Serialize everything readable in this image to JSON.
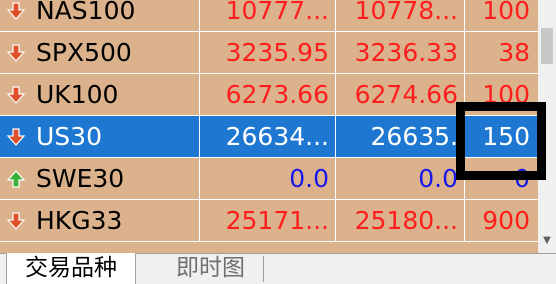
{
  "symbols": [
    {
      "symbol": "NAS100",
      "bid": "10777...",
      "ask": "10778...",
      "spread": "100",
      "direction": "down",
      "color": "red"
    },
    {
      "symbol": "SPX500",
      "bid": "3235.95",
      "ask": "3236.33",
      "spread": "38",
      "direction": "down",
      "color": "red"
    },
    {
      "symbol": "UK100",
      "bid": "6273.66",
      "ask": "6274.66",
      "spread": "100",
      "direction": "down",
      "color": "red"
    },
    {
      "symbol": "US30",
      "bid": "26634...",
      "ask": "26635.",
      "spread": "150",
      "direction": "down",
      "color": "red",
      "selected": true
    },
    {
      "symbol": "SWE30",
      "bid": "0.0",
      "ask": "0.0",
      "spread": "0",
      "direction": "up",
      "color": "blue"
    },
    {
      "symbol": "HKG33",
      "bid": "25171...",
      "ask": "25180...",
      "spread": "900",
      "direction": "down",
      "color": "red"
    }
  ],
  "tabs": {
    "active": "交易品种",
    "inactive": "即时图"
  },
  "colors": {
    "row_background": "#dcb28c",
    "selected_background": "#1e78d2",
    "price_red": "#ff1e1e",
    "price_blue": "#1818e8",
    "arrow_down": "#e0502a",
    "arrow_up": "#3cb43c",
    "highlight_border": "#000000"
  },
  "icons": {
    "down": "arrow-down-icon",
    "up": "arrow-up-icon"
  }
}
